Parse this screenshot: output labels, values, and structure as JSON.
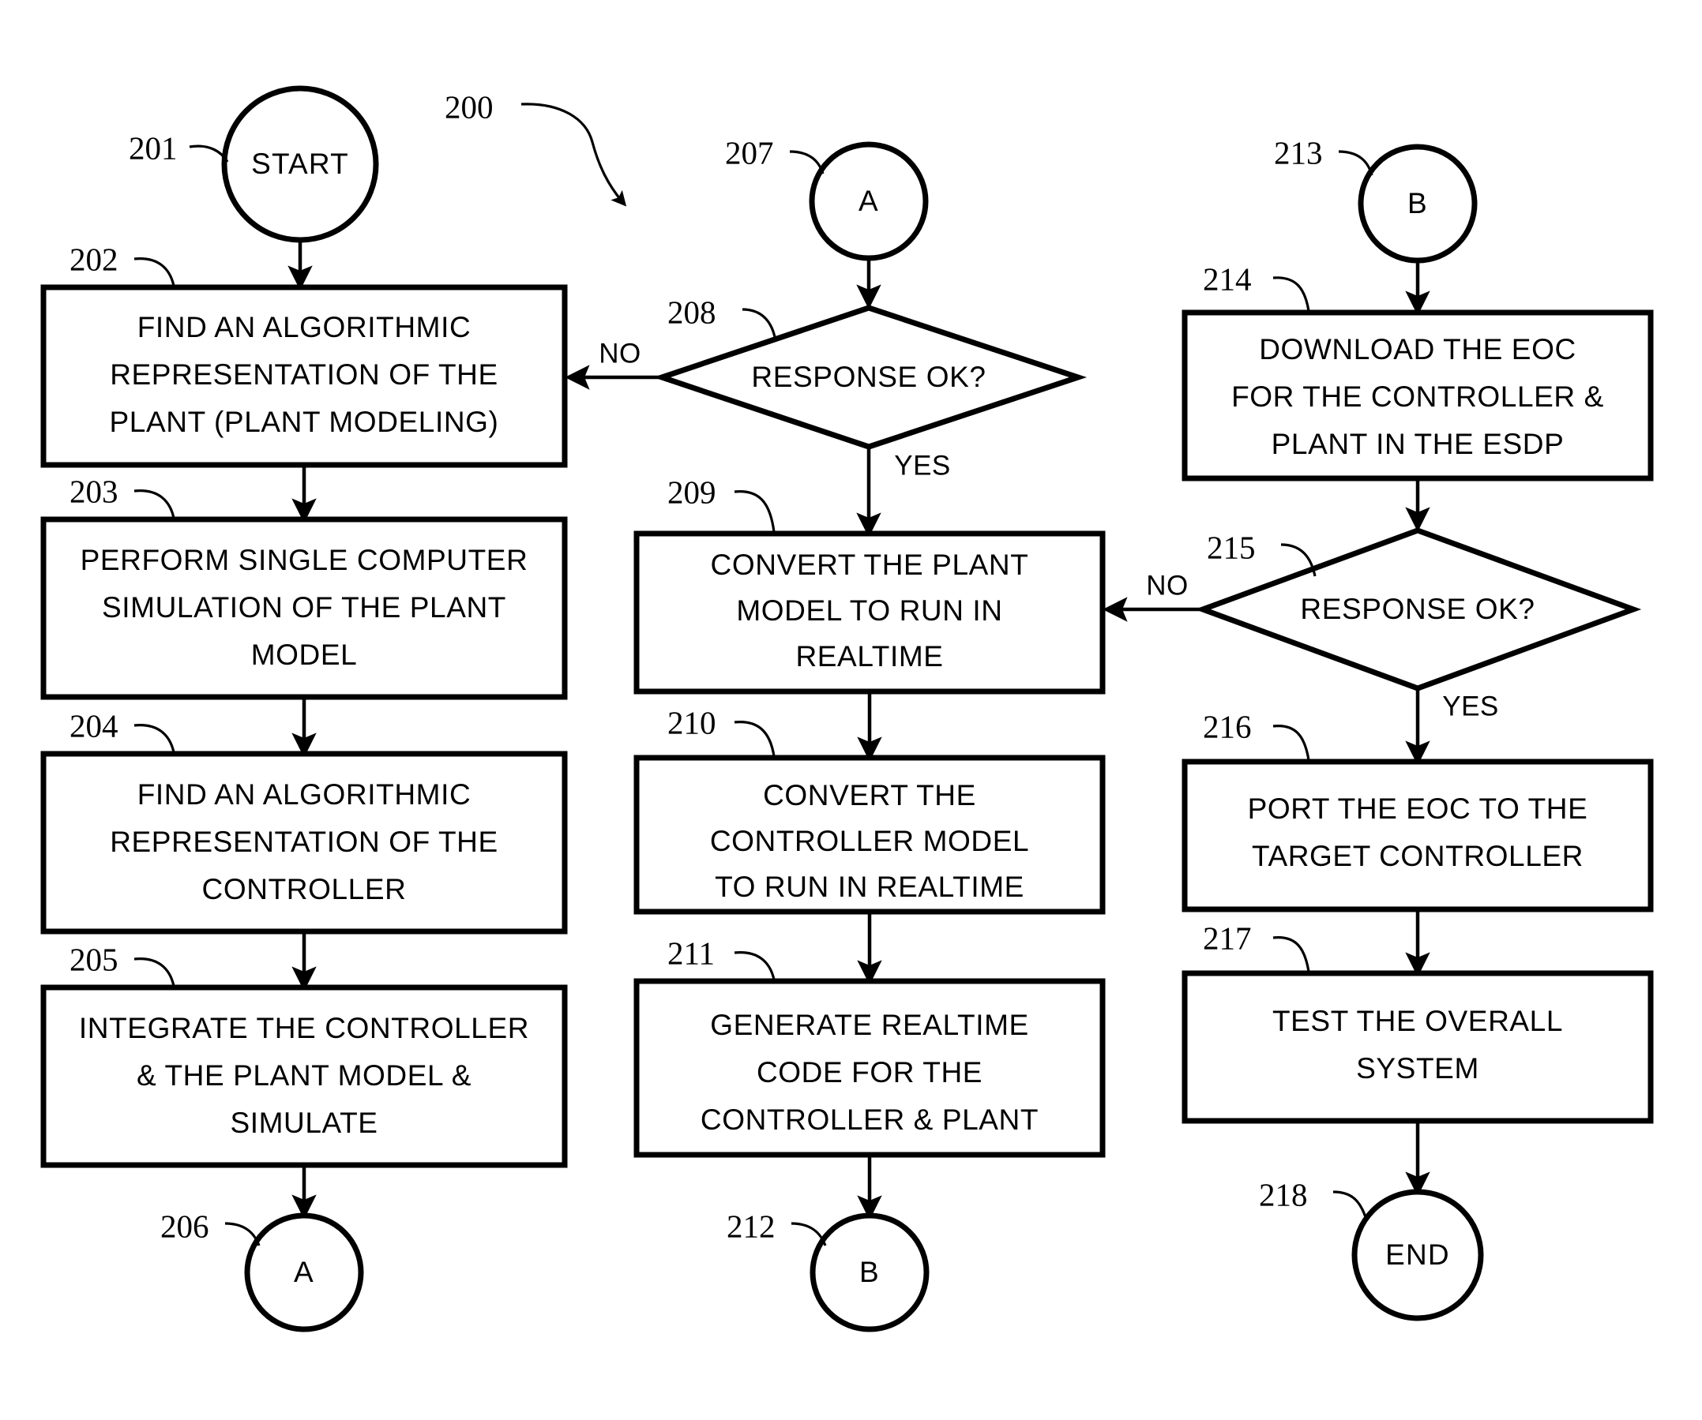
{
  "figure": {
    "reference": "200",
    "type": "flowchart"
  },
  "chart_data": {
    "type": "diagram",
    "title": "",
    "nodes": [
      {
        "ref": "201",
        "shape": "terminator",
        "text": "START"
      },
      {
        "ref": "202",
        "shape": "process",
        "lines": [
          "FIND AN ALGORITHMIC",
          "REPRESENTATION OF THE",
          "PLANT (PLANT MODELING)"
        ]
      },
      {
        "ref": "203",
        "shape": "process",
        "lines": [
          "PERFORM SINGLE COMPUTER",
          "SIMULATION OF THE PLANT",
          "MODEL"
        ]
      },
      {
        "ref": "204",
        "shape": "process",
        "lines": [
          "FIND AN ALGORITHMIC",
          "REPRESENTATION OF THE",
          "CONTROLLER"
        ]
      },
      {
        "ref": "205",
        "shape": "process",
        "lines": [
          "INTEGRATE THE CONTROLLER",
          "& THE PLANT MODEL &",
          "SIMULATE"
        ]
      },
      {
        "ref": "206",
        "shape": "connector",
        "text": "A"
      },
      {
        "ref": "207",
        "shape": "connector",
        "text": "A"
      },
      {
        "ref": "208",
        "shape": "decision",
        "text": "RESPONSE OK?"
      },
      {
        "ref": "209",
        "shape": "process",
        "lines": [
          "CONVERT THE PLANT",
          "MODEL TO  RUN IN",
          "REALTIME"
        ]
      },
      {
        "ref": "210",
        "shape": "process",
        "lines": [
          "CONVERT THE",
          "CONTROLLER MODEL",
          "TO  RUN IN REALTIME"
        ]
      },
      {
        "ref": "211",
        "shape": "process",
        "lines": [
          "GENERATE  REALTIME",
          "CODE FOR THE",
          "CONTROLLER & PLANT"
        ]
      },
      {
        "ref": "212",
        "shape": "connector",
        "text": "B"
      },
      {
        "ref": "213",
        "shape": "connector",
        "text": "B"
      },
      {
        "ref": "214",
        "shape": "process",
        "lines": [
          "DOWNLOAD THE EOC",
          "FOR THE CONTROLLER &",
          "PLANT IN THE  ESDP"
        ]
      },
      {
        "ref": "215",
        "shape": "decision",
        "text": "RESPONSE OK?"
      },
      {
        "ref": "216",
        "shape": "process",
        "lines": [
          "PORT THE EOC  TO THE",
          "TARGET CONTROLLER"
        ]
      },
      {
        "ref": "217",
        "shape": "process",
        "lines": [
          "TEST THE OVERALL",
          "SYSTEM"
        ]
      },
      {
        "ref": "218",
        "shape": "terminator",
        "text": "END"
      }
    ],
    "edge_labels": [
      {
        "id": "no-208",
        "text": "NO"
      },
      {
        "id": "yes-208",
        "text": "YES"
      },
      {
        "id": "no-215",
        "text": "NO"
      },
      {
        "id": "yes-215",
        "text": "YES"
      }
    ],
    "edges": [
      {
        "from": "201",
        "to": "202"
      },
      {
        "from": "202",
        "to": "203"
      },
      {
        "from": "203",
        "to": "204"
      },
      {
        "from": "204",
        "to": "205"
      },
      {
        "from": "205",
        "to": "206"
      },
      {
        "from": "207",
        "to": "208"
      },
      {
        "from": "208",
        "to": "202",
        "label": "NO"
      },
      {
        "from": "208",
        "to": "209",
        "label": "YES"
      },
      {
        "from": "209",
        "to": "210"
      },
      {
        "from": "210",
        "to": "211"
      },
      {
        "from": "211",
        "to": "212"
      },
      {
        "from": "213",
        "to": "214"
      },
      {
        "from": "214",
        "to": "215"
      },
      {
        "from": "215",
        "to": "209",
        "label": "NO"
      },
      {
        "from": "215",
        "to": "216",
        "label": "YES"
      },
      {
        "from": "216",
        "to": "217"
      },
      {
        "from": "217",
        "to": "218"
      }
    ]
  },
  "labels": {
    "fig_ref": "200",
    "n201": "201",
    "n202": "202",
    "n203": "203",
    "n204": "204",
    "n205": "205",
    "n206": "206",
    "n207": "207",
    "n208": "208",
    "n209": "209",
    "n210": "210",
    "n211": "211",
    "n212": "212",
    "n213": "213",
    "n214": "214",
    "n215": "215",
    "n216": "216",
    "n217": "217",
    "n218": "218"
  },
  "text": {
    "start": "START",
    "end": "END",
    "connector_a": "A",
    "connector_b": "B",
    "no": "NO",
    "yes": "YES",
    "response_ok": "RESPONSE OK?",
    "b202_l1": "FIND AN ALGORITHMIC",
    "b202_l2": "REPRESENTATION OF THE",
    "b202_l3": "PLANT (PLANT MODELING)",
    "b203_l1": "PERFORM SINGLE COMPUTER",
    "b203_l2": "SIMULATION OF THE PLANT",
    "b203_l3": "MODEL",
    "b204_l1": "FIND AN ALGORITHMIC",
    "b204_l2": "REPRESENTATION OF THE",
    "b204_l3": "CONTROLLER",
    "b205_l1": "INTEGRATE THE CONTROLLER",
    "b205_l2": "& THE PLANT MODEL &",
    "b205_l3": "SIMULATE",
    "b209_l1": "CONVERT THE PLANT",
    "b209_l2": "MODEL TO  RUN IN",
    "b209_l3": "REALTIME",
    "b210_l1": "CONVERT THE",
    "b210_l2": "CONTROLLER MODEL",
    "b210_l3": "TO  RUN IN REALTIME",
    "b211_l1": "GENERATE  REALTIME",
    "b211_l2": "CODE FOR THE",
    "b211_l3": "CONTROLLER & PLANT",
    "b214_l1": "DOWNLOAD THE EOC",
    "b214_l2": "FOR THE CONTROLLER &",
    "b214_l3": "PLANT IN THE  ESDP",
    "b216_l1": "PORT THE EOC  TO THE",
    "b216_l2": "TARGET CONTROLLER",
    "b217_l1": "TEST THE OVERALL",
    "b217_l2": "SYSTEM"
  }
}
